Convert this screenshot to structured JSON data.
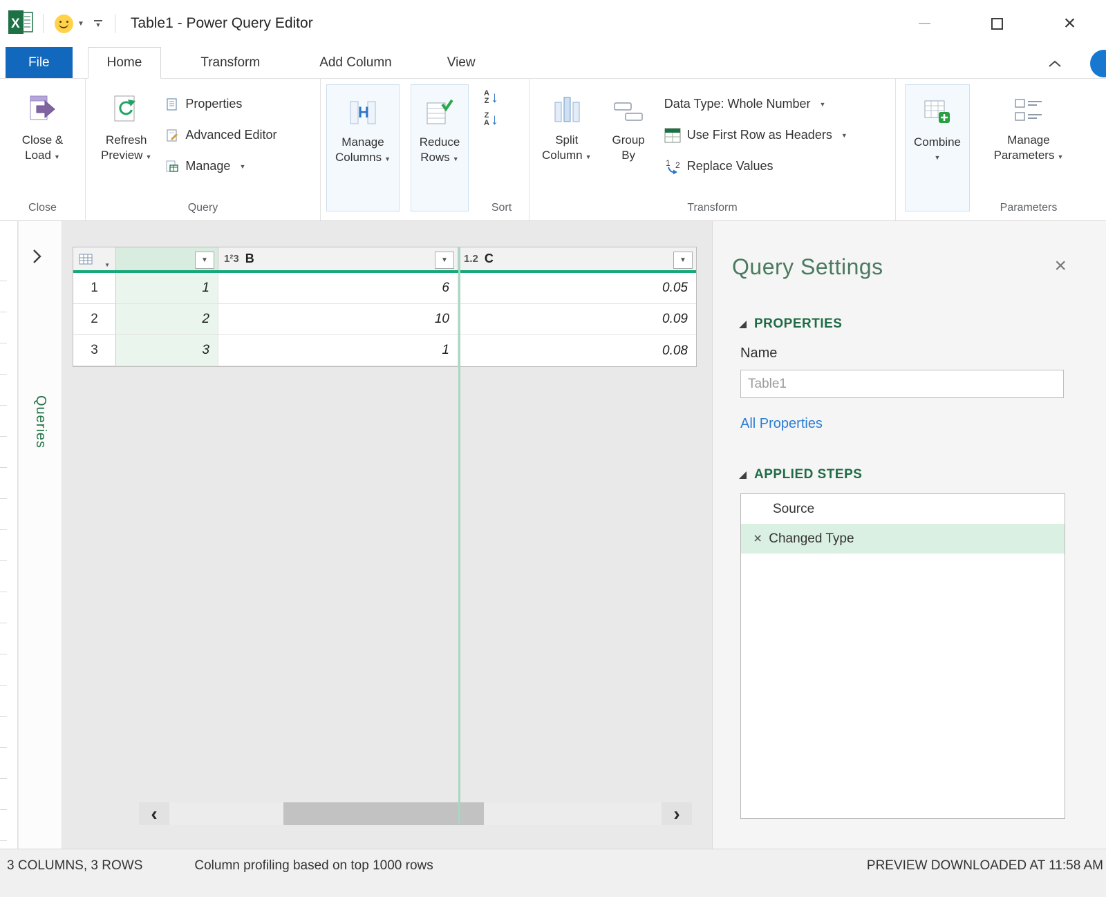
{
  "colors": {
    "file_tab_blue": "#1168bd",
    "accent_green": "#217346",
    "header_underline_teal": "#15a87a",
    "selected_column_fill": "#eaf5ee",
    "selected_step_fill": "#daf0e3",
    "link_blue": "#2b7cd3"
  },
  "window": {
    "title": "Table1 - Power Query Editor"
  },
  "tabs": [
    {
      "label": "File"
    },
    {
      "label": "Home"
    },
    {
      "label": "Transform"
    },
    {
      "label": "Add Column"
    },
    {
      "label": "View"
    }
  ],
  "ribbon": {
    "close_load": {
      "line1": "Close &",
      "line2": "Load"
    },
    "refresh": {
      "line1": "Refresh",
      "line2": "Preview"
    },
    "properties": "Properties",
    "advanced_editor": "Advanced Editor",
    "manage": "Manage",
    "manage_columns": {
      "line1": "Manage",
      "line2": "Columns"
    },
    "reduce_rows": {
      "line1": "Reduce",
      "line2": "Rows"
    },
    "split_column": {
      "line1": "Split",
      "line2": "Column"
    },
    "group_by": {
      "line1": "Group",
      "line2": "By"
    },
    "data_type": "Data Type: Whole Number",
    "use_first_row": "Use First Row as Headers",
    "replace_values": "Replace Values",
    "combine": "Combine",
    "manage_parameters": {
      "line1": "Manage",
      "line2": "Parameters"
    },
    "groups": {
      "close": "Close",
      "query": "Query",
      "sort": "Sort",
      "transform": "Transform",
      "parameters": "Parameters"
    }
  },
  "queries_pane": {
    "label": "Queries"
  },
  "grid": {
    "columns": [
      {
        "type_label": "",
        "name": ""
      },
      {
        "type_label": "1²3",
        "name": "B"
      },
      {
        "type_label": "1.2",
        "name": "C"
      }
    ],
    "rows": [
      {
        "index": "1",
        "cells": [
          "1",
          "6",
          "0.05"
        ]
      },
      {
        "index": "2",
        "cells": [
          "2",
          "10",
          "0.09"
        ]
      },
      {
        "index": "3",
        "cells": [
          "3",
          "1",
          "0.08"
        ]
      }
    ]
  },
  "settings": {
    "title": "Query Settings",
    "properties_header": "PROPERTIES",
    "name_label": "Name",
    "name_value": "Table1",
    "all_properties_link": "All Properties",
    "applied_steps_header": "APPLIED STEPS",
    "steps": [
      {
        "label": "Source"
      },
      {
        "label": "Changed Type"
      }
    ]
  },
  "statusbar": {
    "left": "3 COLUMNS, 3 ROWS",
    "center": "Column profiling based on top 1000 rows",
    "right": "PREVIEW DOWNLOADED AT 11:58 AM"
  },
  "icons": {
    "dropdown_caret": "▼",
    "close_glyph": "×",
    "scroll_left": "‹",
    "scroll_right": "›",
    "sort": {
      "a": "A",
      "z": "Z",
      "arrow": "↓"
    }
  }
}
